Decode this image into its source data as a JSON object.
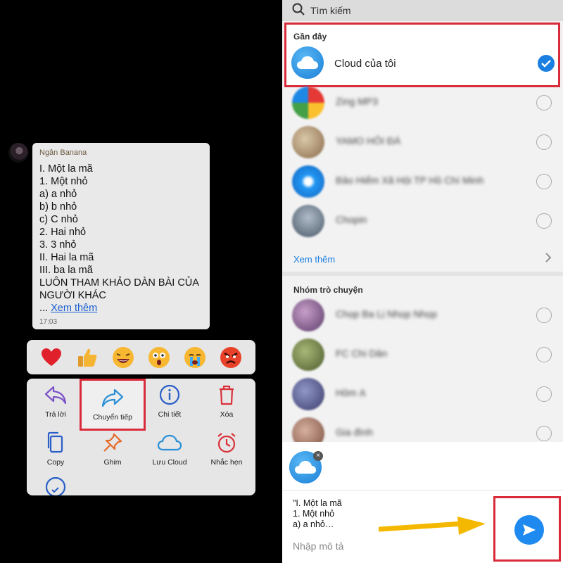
{
  "message": {
    "sender": "Ngân Banana",
    "lines": [
      "I. Một la mã",
      "1. Một nhỏ",
      "a) a nhỏ",
      "b) b nhỏ",
      "c) C nhỏ",
      "2. Hai nhỏ",
      "3. 3 nhỏ",
      "II. Hai la mã",
      "III. ba la mã",
      "LUÔN THAM KHẢO DÀN BÀI CỦA",
      "NGƯỜI KHÁC"
    ],
    "ellipsis": "... ",
    "see_more": "Xem thêm",
    "time": "17:03"
  },
  "reactions": [
    "heart-icon",
    "thumbs-up-icon",
    "laughing-face-icon",
    "surprised-face-icon",
    "crying-face-icon",
    "angry-face-icon"
  ],
  "actions": {
    "reply": "Trả lời",
    "forward": "Chuyển tiếp",
    "details": "Chi tiết",
    "delete": "Xóa",
    "copy": "Copy",
    "pin": "Ghim",
    "save_cloud": "Lưu Cloud",
    "remind": "Nhắc hẹn"
  },
  "share": {
    "search_placeholder": "Tìm kiếm",
    "recent_title": "Gần đây",
    "cloud_name": "Cloud của tôi",
    "recent_contacts": [
      "Zing MP3",
      "YAMO HỎI ĐÁ",
      "Bảo Hiểm Xã Hội TP Hồ Chí Minh",
      "Chopin"
    ],
    "see_more": "Xem thêm",
    "groups_title": "Nhóm trò chuyện",
    "groups": [
      "Chọp Ba Lị Nhọp Nhọp",
      "FC Chi Dân",
      "Hôm Ạ",
      "Gia đình"
    ],
    "preview": [
      "\"I. Một la mã",
      "1. Một nhỏ",
      "a) a nhỏ…"
    ],
    "description_placeholder": "Nhập mô tả",
    "accent": "#1a7fe0",
    "highlight": "#d92b3a"
  }
}
